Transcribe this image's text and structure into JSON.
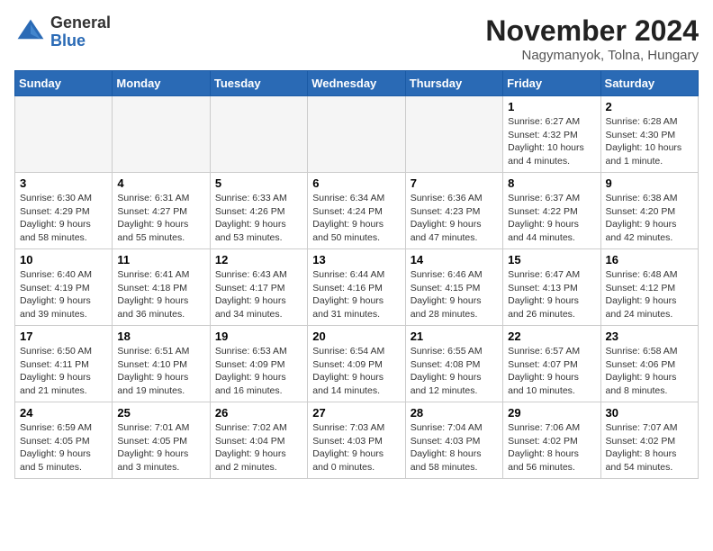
{
  "logo": {
    "general": "General",
    "blue": "Blue"
  },
  "title": "November 2024",
  "location": "Nagymanyok, Tolna, Hungary",
  "weekdays": [
    "Sunday",
    "Monday",
    "Tuesday",
    "Wednesday",
    "Thursday",
    "Friday",
    "Saturday"
  ],
  "weeks": [
    [
      {
        "day": "",
        "info": ""
      },
      {
        "day": "",
        "info": ""
      },
      {
        "day": "",
        "info": ""
      },
      {
        "day": "",
        "info": ""
      },
      {
        "day": "",
        "info": ""
      },
      {
        "day": "1",
        "info": "Sunrise: 6:27 AM\nSunset: 4:32 PM\nDaylight: 10 hours and 4 minutes."
      },
      {
        "day": "2",
        "info": "Sunrise: 6:28 AM\nSunset: 4:30 PM\nDaylight: 10 hours and 1 minute."
      }
    ],
    [
      {
        "day": "3",
        "info": "Sunrise: 6:30 AM\nSunset: 4:29 PM\nDaylight: 9 hours and 58 minutes."
      },
      {
        "day": "4",
        "info": "Sunrise: 6:31 AM\nSunset: 4:27 PM\nDaylight: 9 hours and 55 minutes."
      },
      {
        "day": "5",
        "info": "Sunrise: 6:33 AM\nSunset: 4:26 PM\nDaylight: 9 hours and 53 minutes."
      },
      {
        "day": "6",
        "info": "Sunrise: 6:34 AM\nSunset: 4:24 PM\nDaylight: 9 hours and 50 minutes."
      },
      {
        "day": "7",
        "info": "Sunrise: 6:36 AM\nSunset: 4:23 PM\nDaylight: 9 hours and 47 minutes."
      },
      {
        "day": "8",
        "info": "Sunrise: 6:37 AM\nSunset: 4:22 PM\nDaylight: 9 hours and 44 minutes."
      },
      {
        "day": "9",
        "info": "Sunrise: 6:38 AM\nSunset: 4:20 PM\nDaylight: 9 hours and 42 minutes."
      }
    ],
    [
      {
        "day": "10",
        "info": "Sunrise: 6:40 AM\nSunset: 4:19 PM\nDaylight: 9 hours and 39 minutes."
      },
      {
        "day": "11",
        "info": "Sunrise: 6:41 AM\nSunset: 4:18 PM\nDaylight: 9 hours and 36 minutes."
      },
      {
        "day": "12",
        "info": "Sunrise: 6:43 AM\nSunset: 4:17 PM\nDaylight: 9 hours and 34 minutes."
      },
      {
        "day": "13",
        "info": "Sunrise: 6:44 AM\nSunset: 4:16 PM\nDaylight: 9 hours and 31 minutes."
      },
      {
        "day": "14",
        "info": "Sunrise: 6:46 AM\nSunset: 4:15 PM\nDaylight: 9 hours and 28 minutes."
      },
      {
        "day": "15",
        "info": "Sunrise: 6:47 AM\nSunset: 4:13 PM\nDaylight: 9 hours and 26 minutes."
      },
      {
        "day": "16",
        "info": "Sunrise: 6:48 AM\nSunset: 4:12 PM\nDaylight: 9 hours and 24 minutes."
      }
    ],
    [
      {
        "day": "17",
        "info": "Sunrise: 6:50 AM\nSunset: 4:11 PM\nDaylight: 9 hours and 21 minutes."
      },
      {
        "day": "18",
        "info": "Sunrise: 6:51 AM\nSunset: 4:10 PM\nDaylight: 9 hours and 19 minutes."
      },
      {
        "day": "19",
        "info": "Sunrise: 6:53 AM\nSunset: 4:09 PM\nDaylight: 9 hours and 16 minutes."
      },
      {
        "day": "20",
        "info": "Sunrise: 6:54 AM\nSunset: 4:09 PM\nDaylight: 9 hours and 14 minutes."
      },
      {
        "day": "21",
        "info": "Sunrise: 6:55 AM\nSunset: 4:08 PM\nDaylight: 9 hours and 12 minutes."
      },
      {
        "day": "22",
        "info": "Sunrise: 6:57 AM\nSunset: 4:07 PM\nDaylight: 9 hours and 10 minutes."
      },
      {
        "day": "23",
        "info": "Sunrise: 6:58 AM\nSunset: 4:06 PM\nDaylight: 9 hours and 8 minutes."
      }
    ],
    [
      {
        "day": "24",
        "info": "Sunrise: 6:59 AM\nSunset: 4:05 PM\nDaylight: 9 hours and 5 minutes."
      },
      {
        "day": "25",
        "info": "Sunrise: 7:01 AM\nSunset: 4:05 PM\nDaylight: 9 hours and 3 minutes."
      },
      {
        "day": "26",
        "info": "Sunrise: 7:02 AM\nSunset: 4:04 PM\nDaylight: 9 hours and 2 minutes."
      },
      {
        "day": "27",
        "info": "Sunrise: 7:03 AM\nSunset: 4:03 PM\nDaylight: 9 hours and 0 minutes."
      },
      {
        "day": "28",
        "info": "Sunrise: 7:04 AM\nSunset: 4:03 PM\nDaylight: 8 hours and 58 minutes."
      },
      {
        "day": "29",
        "info": "Sunrise: 7:06 AM\nSunset: 4:02 PM\nDaylight: 8 hours and 56 minutes."
      },
      {
        "day": "30",
        "info": "Sunrise: 7:07 AM\nSunset: 4:02 PM\nDaylight: 8 hours and 54 minutes."
      }
    ]
  ]
}
